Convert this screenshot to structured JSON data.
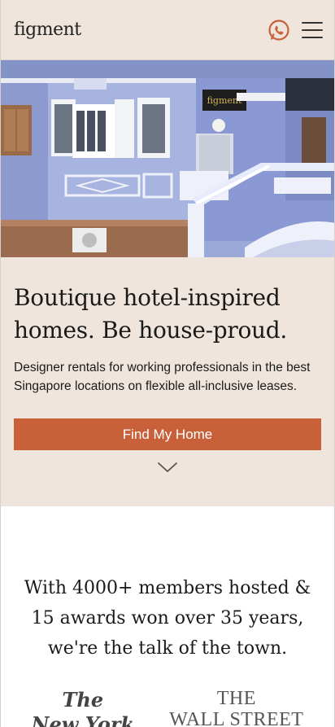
{
  "header": {
    "logo": "figment",
    "whatsapp_icon": "whatsapp-icon",
    "menu_icon": "hamburger-menu-icon"
  },
  "hero": {
    "sign_text": "figment",
    "headline_line1": "Boutique hotel-inspired",
    "headline_line2": "homes. Be house-proud.",
    "subtext": "Designer rentals for working professionals in the best Singapore locations on flexible all-inclusive leases.",
    "cta_label": "Find My Home",
    "scroll_icon": "chevron-down-icon"
  },
  "proof": {
    "text": "With 4000+ members hosted & 15 awards won over 35 years, we're the talk of the town.",
    "press": [
      {
        "line1": "The",
        "line2": "New York"
      },
      {
        "line1": "THE",
        "line2": "WALL STREET"
      }
    ]
  },
  "colors": {
    "background_beige": "#efe5dc",
    "accent_orange": "#c8603a",
    "facade_blue": "#8ea1d6"
  }
}
